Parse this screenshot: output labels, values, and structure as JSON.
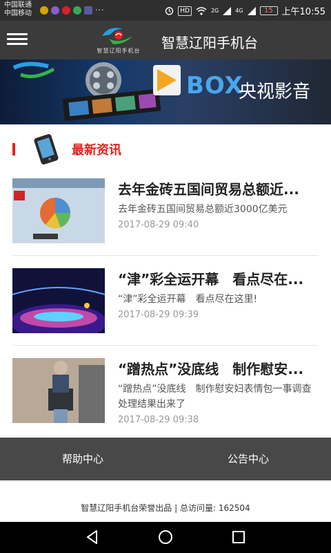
{
  "status_bar": {
    "carrier_1": "中国联通",
    "carrier_2": "中国移动",
    "network_badge": "HD",
    "signal_2g": "2G",
    "signal_4g": "4G",
    "battery": "15",
    "time": "上午10:55"
  },
  "app_bar": {
    "title": "智慧辽阳手机台",
    "logo_caption": "智慧辽阳手机台"
  },
  "banner": {
    "brand": "BOX",
    "subtitle": "央视影音"
  },
  "section": {
    "title": "最新资讯"
  },
  "news": [
    {
      "headline": "去年金砖五国间贸易总额近...",
      "summary": "去年金砖五国间贸易总额近3000亿美元",
      "date": "2017-08-29 09:40"
    },
    {
      "headline": "“津”彩全运开幕　看点尽在...",
      "summary": "“津”彩全运开幕　看点尽在这里!",
      "date": "2017-08-29 09:39"
    },
    {
      "headline": "“蹭热点”没底线　制作慰安...",
      "summary": "“蹭热点”没底线　制作慰安妇表情包一事调查处理结果出来了",
      "date": "2017-08-29 09:38"
    }
  ],
  "bottom_tabs": {
    "help": "帮助中心",
    "notice": "公告中心"
  },
  "footer": {
    "credit": "智慧辽阳手机台荣誉出品",
    "visits_label": "总访问量:",
    "visits_count": "162504"
  },
  "colors": {
    "accent_red": "#e5221e",
    "app_bar": "#3b3b3b",
    "bottom_tabs": "#484848"
  }
}
